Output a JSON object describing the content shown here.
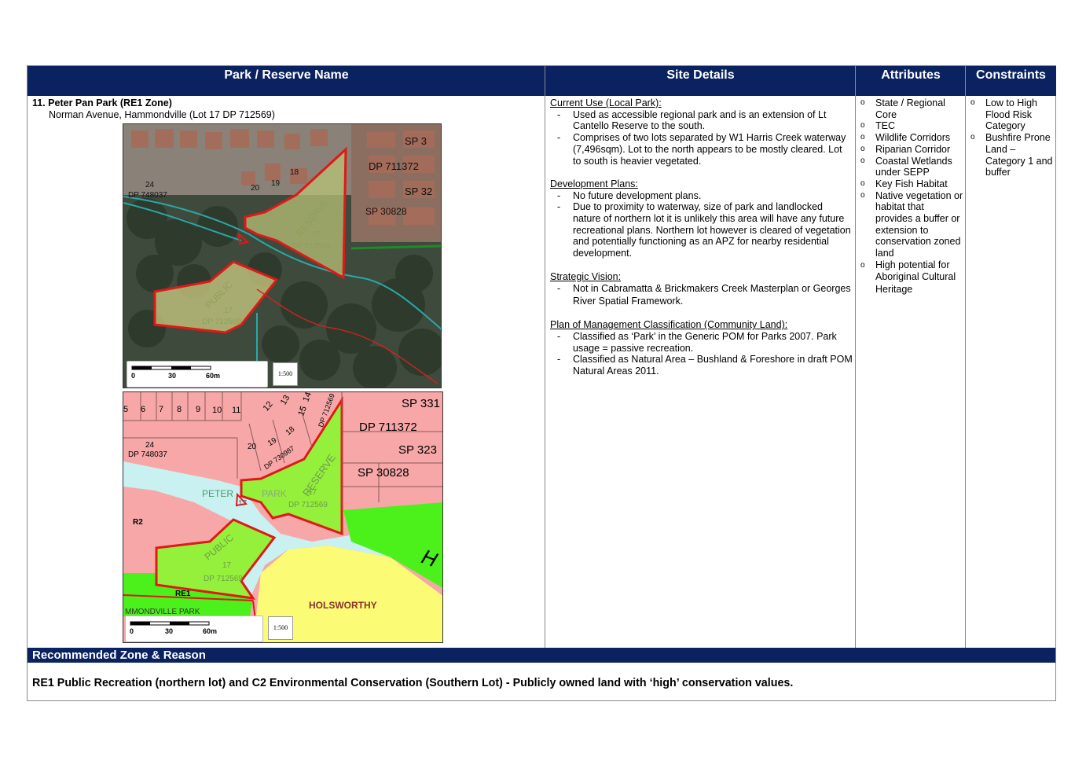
{
  "headers": {
    "park_name": "Park / Reserve Name",
    "site_details": "Site Details",
    "attributes": "Attributes",
    "constraints": "Constraints"
  },
  "park": {
    "title": "11. Peter Pan Park (RE1 Zone)",
    "address": "Norman Avenue, Hammondville (Lot 17 DP 712569)"
  },
  "aerial_map": {
    "labels": [
      "SP 3",
      "DP 711372",
      "SP 32",
      "SP 30828",
      "24",
      "DP 748037",
      "20",
      "19",
      "18",
      "RESERVE",
      "17",
      "DP 712569",
      "PUBLIC",
      "17",
      "DP 712569"
    ],
    "scale": {
      "ticks": [
        "0",
        "30",
        "60m"
      ],
      "ratio": "1:500"
    }
  },
  "zoning_map": {
    "lot_numbers": [
      "5",
      "6",
      "7",
      "8",
      "9",
      "10",
      "11",
      "12",
      "13",
      "15",
      "14"
    ],
    "labels": {
      "sp331": "SP 331",
      "dp711372": "DP 711372",
      "sp323": "SP 323",
      "sp30828": "SP 30828",
      "l24": "24",
      "dp748037": "DP 748037",
      "l20": "20",
      "l19": "19",
      "l18": "18",
      "dp730987": "DP 730987",
      "dp712569_top": "DP 712569",
      "peter": "PETER",
      "park": "PARK",
      "l17a": "17",
      "reserve": "RESERVE",
      "l17b": "17",
      "dp712569_res": "DP 712569",
      "r2": "R2",
      "public": "PUBLIC",
      "l17c": "17",
      "dp712569_pub": "DP 712569",
      "re1": "RE1",
      "hammondville_park": "MMONDVILLE PARK",
      "holsworthy": "HOLSWORTHY",
      "h": "H"
    },
    "scale": {
      "ticks": [
        "0",
        "30",
        "60m"
      ],
      "ratio": "1:500"
    },
    "colors": {
      "residential": "#f7a7a7",
      "public_rec": "#94f03a",
      "env": "#4cf01a",
      "waterway": "#c9f1f1",
      "special": "#fbfb76",
      "boundary": "#e01818"
    }
  },
  "site_details": {
    "current_use_heading": "Current Use (Local Park):",
    "current_use": [
      "Used as accessible regional park and is an extension of Lt Cantello Reserve to the south.",
      "Comprises of two lots separated by W1 Harris Creek waterway (7,496sqm). Lot to the north appears to be mostly cleared. Lot to south is heavier vegetated."
    ],
    "dev_plans_heading": "Development Plans:",
    "dev_plans": [
      "No future development plans.",
      "Due to proximity to waterway, size of park and landlocked nature of northern lot it is unlikely this area will have any future recreational plans. Northern lot however is cleared of vegetation and potentially functioning as an APZ for nearby residential development."
    ],
    "strategic_heading": "Strategic Vision:",
    "strategic": [
      "Not in Cabramatta & Brickmakers Creek Masterplan or Georges River Spatial Framework."
    ],
    "pom_heading": "Plan of Management Classification (Community Land):",
    "pom": [
      "Classified as ‘Park’ in the Generic POM for Parks 2007. Park usage = passive recreation.",
      "Classified as Natural Area – Bushland & Foreshore in draft POM Natural Areas 2011."
    ]
  },
  "attributes": [
    "State / Regional Core",
    "TEC",
    "Wildlife Corridors",
    "Riparian Corridor",
    "Coastal Wetlands under SEPP",
    "Key Fish Habitat",
    "Native vegetation or habitat that provides a buffer or extension to conservation zoned land",
    "High potential for Aboriginal Cultural Heritage"
  ],
  "constraints": [
    "Low to High Flood Risk Category",
    "Bushfire Prone Land – Category 1 and buffer"
  ],
  "recommended": {
    "heading": "Recommended Zone & Reason",
    "text": "RE1 Public Recreation (northern lot) and C2 Environmental Conservation (Southern Lot) - Publicly owned land with ‘high’ conservation values."
  }
}
